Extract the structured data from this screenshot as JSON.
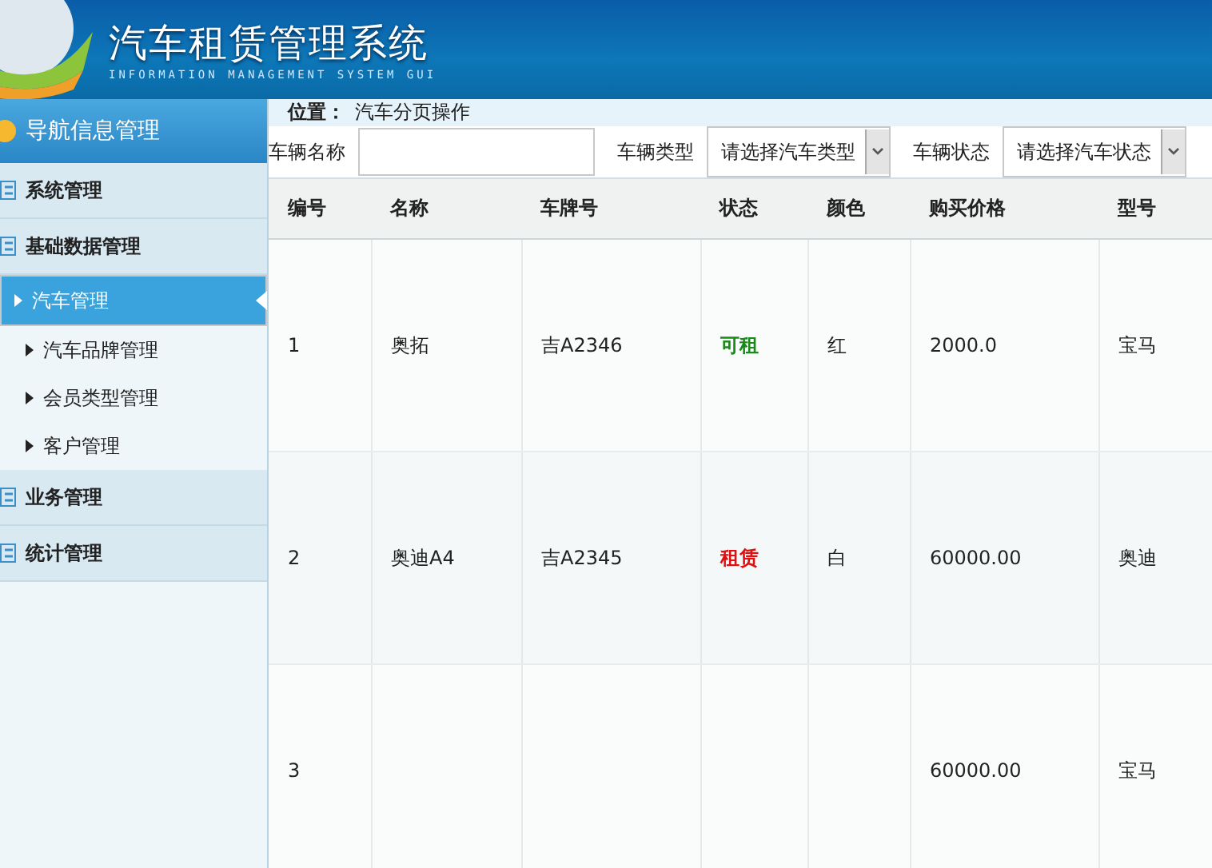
{
  "header": {
    "title": "汽车租赁管理系统",
    "subtitle": "INFORMATION MANAGEMENT SYSTEM GUI"
  },
  "sidebar": {
    "title": "导航信息管理",
    "groups": [
      {
        "label": "系统管理"
      },
      {
        "label": "基础数据管理",
        "children": [
          {
            "label": "汽车管理",
            "selected": true
          },
          {
            "label": "汽车品牌管理",
            "selected": false
          },
          {
            "label": "会员类型管理",
            "selected": false
          },
          {
            "label": "客户管理",
            "selected": false
          }
        ]
      },
      {
        "label": "业务管理"
      },
      {
        "label": "统计管理"
      }
    ]
  },
  "breadcrumb": {
    "label": "位置：",
    "value": "汽车分页操作"
  },
  "filters": [
    {
      "kind": "text",
      "label": "车辆名称"
    },
    {
      "kind": "select",
      "label": "车辆类型",
      "value": "请选择汽车类型"
    },
    {
      "kind": "select",
      "label": "车辆状态",
      "value": "请选择汽车状态"
    }
  ],
  "table": {
    "columns": [
      "编号",
      "名称",
      "车牌号",
      "状态",
      "颜色",
      "购买价格",
      "型号"
    ],
    "rows": [
      {
        "number": "1",
        "name": "奥拓",
        "plate": "吉A2346",
        "status": "可租",
        "color": "#1a8a1a",
        "paint": "红",
        "price": "2000.0",
        "model": "宝马"
      },
      {
        "number": "2",
        "name": "奥迪A4",
        "plate": "吉A2345",
        "status": "租赁",
        "color": "#e01010",
        "paint": "白",
        "price": "60000.00",
        "model": "奥迪"
      },
      {
        "number": "3",
        "price": "60000.00",
        "model": "宝马"
      }
    ]
  }
}
